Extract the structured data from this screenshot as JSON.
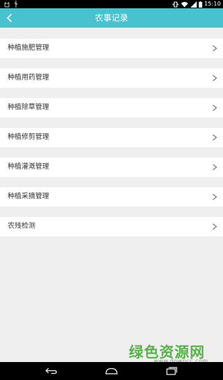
{
  "status_bar": {
    "time": "15:10",
    "icons": [
      "usb-debug-icon",
      "usb-icon",
      "vibrate-icon",
      "wifi-icon",
      "signal-icon",
      "battery-icon"
    ]
  },
  "header": {
    "title": "农事记录",
    "back_icon": "chevron-left-icon"
  },
  "menu": {
    "arrow_glyph": ">",
    "items": [
      {
        "label": "种植施肥管理"
      },
      {
        "label": "种植用药管理"
      },
      {
        "label": "种植除草管理"
      },
      {
        "label": "种植修剪管理"
      },
      {
        "label": "种植灌溉管理"
      },
      {
        "label": "种植采摘管理"
      },
      {
        "label": "农残检测"
      }
    ]
  },
  "watermark": {
    "cn": "绿色资源网",
    "en": "www.downcc.com"
  },
  "nav_bar": {
    "icons": [
      "back-icon",
      "home-icon",
      "recents-icon"
    ]
  },
  "colors": {
    "accent": "#48c2cf",
    "background": "#efefef",
    "watermark_green": "#58b24a"
  }
}
